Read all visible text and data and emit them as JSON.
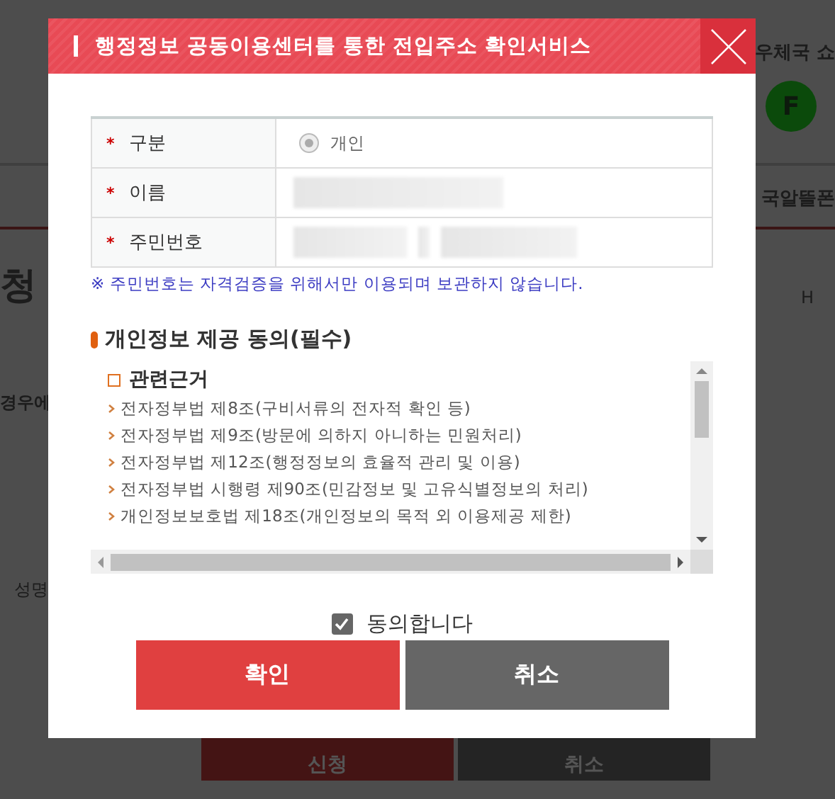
{
  "background_page": {
    "header_link": "우체국 쇼",
    "badge": "F",
    "nav_item": "국알뜰폰",
    "page_title": "청",
    "breadcrumb": "H",
    "text_fragment": "경우에",
    "field_label": "성명",
    "buttons": [
      {
        "label": "신청",
        "kind": "primary"
      },
      {
        "label": "취소",
        "kind": "secondary"
      }
    ]
  },
  "dialog": {
    "title": "행정정보 공동이용센터를 통한 전입주소 확인서비스",
    "form": [
      {
        "label": "구분",
        "required_mark": "*",
        "kind": "radio",
        "option": "개인",
        "selected": true
      },
      {
        "label": "이름",
        "required_mark": "*",
        "kind": "name"
      },
      {
        "label": "주민번호",
        "required_mark": "*",
        "kind": "id_number"
      }
    ],
    "notice": "※ 주민번호는 자격검증을 위해서만 이용되며 보관하지 않습니다.",
    "consent": {
      "title": "개인정보 제공 동의(필수)",
      "heading": "관련근거",
      "items": [
        "전자정부법 제8조(구비서류의 전자적 확인 등)",
        "전자정부법 제9조(방문에 의하지 아니하는 민원처리)",
        "전자정부법 제12조(행정정보의 효율적 관리 및 이용)",
        "전자정부법 시행령 제90조(민감정보 및 고유식별정보의 처리)",
        "개인정보보호법 제18조(개인정보의 목적 외 이용제공 제한)"
      ]
    },
    "agree": {
      "label": "동의합니다",
      "checked": true
    },
    "buttons": [
      {
        "label": "확인",
        "kind": "primary"
      },
      {
        "label": "취소",
        "kind": "secondary"
      }
    ]
  }
}
